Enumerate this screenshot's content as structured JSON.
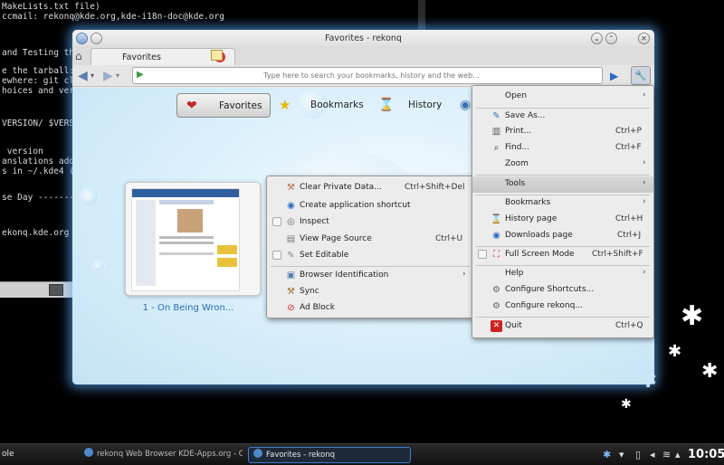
{
  "terminal": {
    "lines": [
      "MakeLists.txt file)",
      "ccmail: rekonq@kde.org,kde-i18n-doc@kde.org",
      "",
      "and Testing the",
      "",
      "e the tarball:",
      "ewhere: git clo",
      "hoices and vers",
      "",
      "",
      "VERSION/ $VERSI",
      "",
      "",
      " version",
      "anslations adde",
      "s in ~/.kde4 (o",
      "",
      "",
      "se Day --------",
      "",
      "",
      "ekonq.kde.org"
    ]
  },
  "window": {
    "title": "Favorites - rekonq",
    "tab_label": "Favorites",
    "url_placeholder": "Type here to search your bookmarks, history and the web...",
    "views": [
      "Favorites",
      "Bookmarks",
      "History"
    ],
    "thumbnail_caption": "1 - On Being Wron..."
  },
  "tools_menu": {
    "items": [
      {
        "label": "Open",
        "shortcut": "",
        "submenu": true,
        "icon": "none"
      },
      {
        "label": "Save As...",
        "shortcut": "",
        "submenu": false,
        "icon": "save-icon"
      },
      {
        "label": "Print...",
        "shortcut": "Ctrl+P",
        "submenu": false,
        "icon": "print-icon"
      },
      {
        "label": "Find...",
        "shortcut": "Ctrl+F",
        "submenu": false,
        "icon": "find-icon"
      },
      {
        "label": "Zoom",
        "shortcut": "",
        "submenu": true,
        "icon": "none"
      },
      {
        "label": "Tools",
        "shortcut": "",
        "submenu": true,
        "icon": "none"
      },
      {
        "label": "Bookmarks",
        "shortcut": "",
        "submenu": true,
        "icon": "none"
      },
      {
        "label": "History page",
        "shortcut": "Ctrl+H",
        "submenu": false,
        "icon": "history-icon"
      },
      {
        "label": "Downloads page",
        "shortcut": "Ctrl+J",
        "submenu": false,
        "icon": "downloads-icon"
      },
      {
        "label": "Full Screen Mode",
        "shortcut": "Ctrl+Shift+F",
        "submenu": false,
        "icon": "fullscreen-icon"
      },
      {
        "label": "Help",
        "shortcut": "",
        "submenu": true,
        "icon": "none"
      },
      {
        "label": "Configure Shortcuts...",
        "shortcut": "",
        "submenu": false,
        "icon": "configure-icon"
      },
      {
        "label": "Configure rekonq...",
        "shortcut": "",
        "submenu": false,
        "icon": "configure-icon"
      },
      {
        "label": "Quit",
        "shortcut": "Ctrl+Q",
        "submenu": false,
        "icon": "quit-icon"
      }
    ]
  },
  "tools_submenu": {
    "items": [
      {
        "label": "Clear Private Data...",
        "shortcut": "Ctrl+Shift+Del",
        "submenu": false
      },
      {
        "label": "Create application shortcut",
        "shortcut": "",
        "submenu": false
      },
      {
        "label": "Inspect",
        "shortcut": "",
        "submenu": false
      },
      {
        "label": "View Page Source",
        "shortcut": "Ctrl+U",
        "submenu": false
      },
      {
        "label": "Set Editable",
        "shortcut": "",
        "submenu": false
      },
      {
        "label": "Browser Identification",
        "shortcut": "",
        "submenu": true
      },
      {
        "label": "Sync",
        "shortcut": "",
        "submenu": false
      },
      {
        "label": "Ad Block",
        "shortcut": "",
        "submenu": false
      }
    ]
  },
  "taskbar": {
    "left_label": "ole",
    "tasks": [
      "rekonq Web Browser KDE-Apps.org - Chr",
      "Favorites - rekonq"
    ],
    "clock": "10:05"
  }
}
